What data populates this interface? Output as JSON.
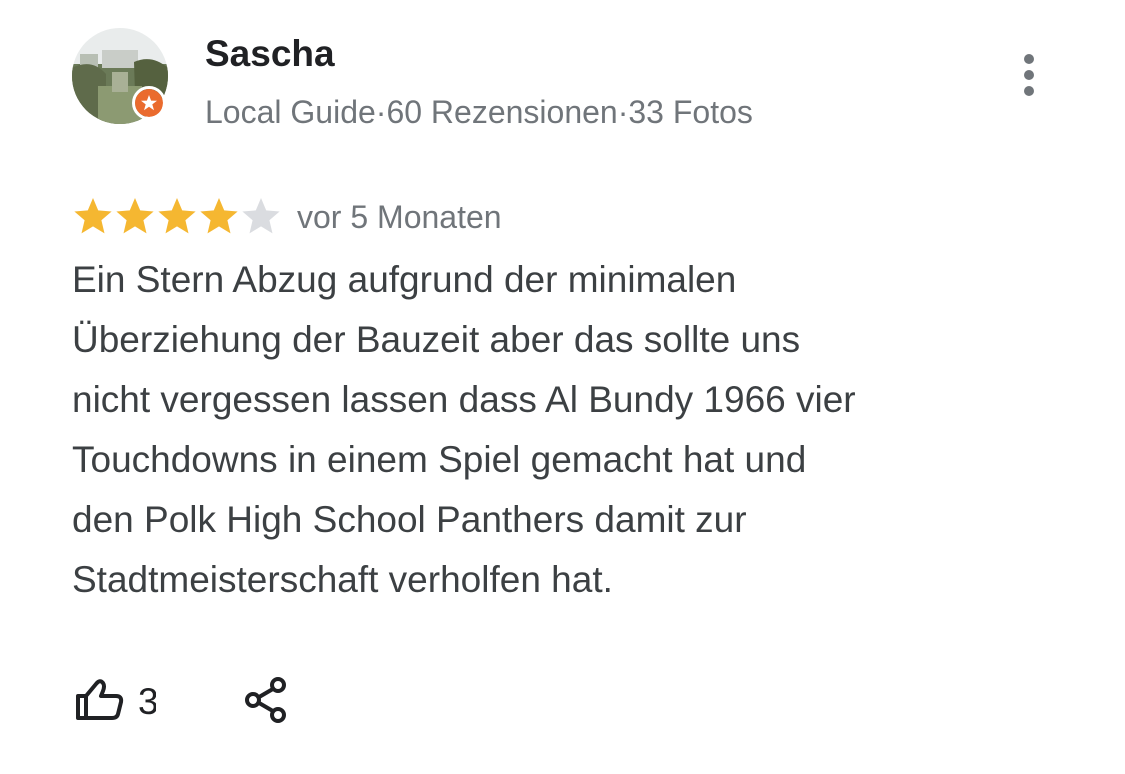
{
  "reviewer": {
    "name": "Sascha",
    "meta": "Local Guide·60 Rezensionen·33 Fotos"
  },
  "review": {
    "rating": 4,
    "max_rating": 5,
    "date": "vor 5 Monaten",
    "lines": [
      "Ein Stern Abzug aufgrund der minimalen",
      "Überziehung der Bauzeit aber das sollte uns",
      "nicht vergessen lassen dass Al Bundy 1966 vier",
      "Touchdowns in einem Spiel gemacht hat und",
      "den Polk High School Panthers damit zur",
      "Stadtmeisterschaft verholfen hat."
    ]
  },
  "actions": {
    "like_count": "3"
  },
  "colors": {
    "star_filled": "#f5b731",
    "star_empty": "#dadce0",
    "badge": "#ea6b2e",
    "text_primary": "#202124",
    "text_secondary": "#70757a",
    "text_body": "#3c4043"
  },
  "icons": {
    "avatar": "avatar-photo",
    "badge": "local-guide-star-badge",
    "more": "more-vertical-icon",
    "like": "thumbs-up-icon",
    "share": "share-icon"
  }
}
